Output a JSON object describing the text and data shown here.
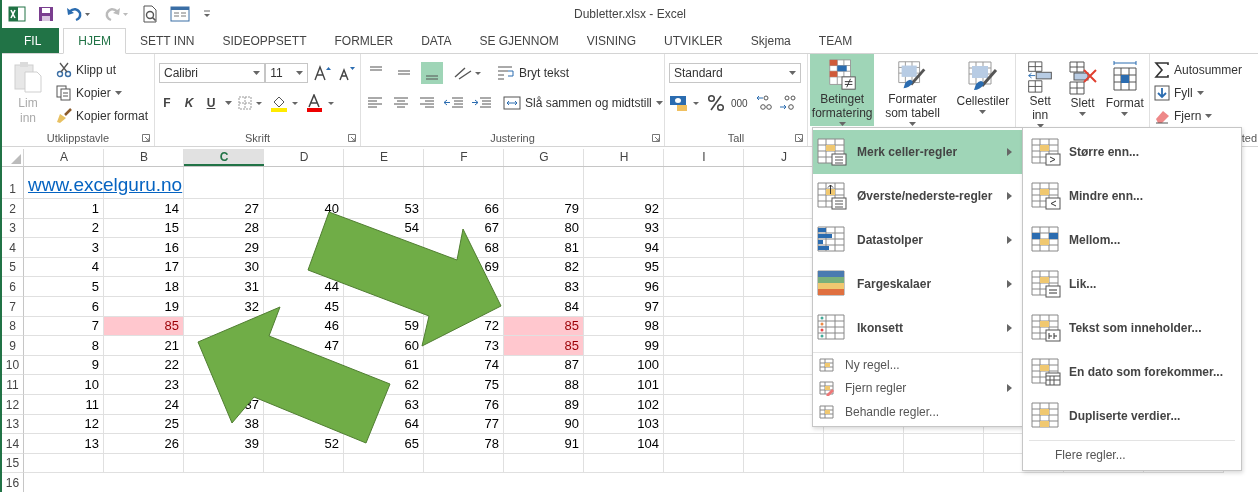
{
  "window": {
    "title": "Dubletter.xlsx - Excel"
  },
  "tabs": [
    {
      "label": "FIL",
      "kind": "file",
      "selected": false
    },
    {
      "label": "HJEM",
      "kind": "tab",
      "selected": true
    },
    {
      "label": "SETT INN",
      "kind": "tab",
      "selected": false
    },
    {
      "label": "SIDEOPPSETT",
      "kind": "tab",
      "selected": false
    },
    {
      "label": "FORMLER",
      "kind": "tab",
      "selected": false
    },
    {
      "label": "DATA",
      "kind": "tab",
      "selected": false
    },
    {
      "label": "SE GJENNOM",
      "kind": "tab",
      "selected": false
    },
    {
      "label": "VISNING",
      "kind": "tab",
      "selected": false
    },
    {
      "label": "UTVIKLER",
      "kind": "tab",
      "selected": false
    },
    {
      "label": "Skjema",
      "kind": "tab",
      "selected": false
    },
    {
      "label": "TEAM",
      "kind": "tab",
      "selected": false
    }
  ],
  "ribbon": {
    "clipboard": {
      "label": "Utklippstavle",
      "paste": {
        "label": "Lim inn",
        "disabled": true
      },
      "buttons": [
        "Klipp ut",
        "Kopier",
        "Kopier format"
      ]
    },
    "font": {
      "label": "Skrift",
      "font_name": "Calibri",
      "font_size": "11",
      "style_buttons": [
        "F",
        "K",
        "U"
      ]
    },
    "alignment": {
      "label": "Justering",
      "vertical_align": [
        {
          "selected": false
        },
        {
          "selected": false
        },
        {
          "selected": true
        }
      ],
      "wrap_text": "Bryt tekst",
      "merge": "Slå sammen og midtstill"
    },
    "number": {
      "label": "Tall",
      "format": "Standard",
      "thousands": "000"
    },
    "styles": {
      "buttons": [
        {
          "label": "Betinget formatering",
          "selected": true
        },
        {
          "label": "Formater som tabell",
          "selected": false
        },
        {
          "label": "Cellestiler",
          "selected": false
        }
      ]
    },
    "cells": {
      "buttons": [
        "Sett inn",
        "Slett",
        "Format"
      ]
    },
    "editing": {
      "label": "ted",
      "buttons": [
        "Autosummer",
        "Fyll",
        "Fjern"
      ]
    }
  },
  "sheet": {
    "columns": [
      {
        "label": "A",
        "selected": false
      },
      {
        "label": "B",
        "selected": false
      },
      {
        "label": "C",
        "selected": true
      },
      {
        "label": "D",
        "selected": false
      },
      {
        "label": "E",
        "selected": false
      },
      {
        "label": "F",
        "selected": false
      },
      {
        "label": "G",
        "selected": false
      },
      {
        "label": "H",
        "selected": false
      },
      {
        "label": "I",
        "selected": false
      },
      {
        "label": "J",
        "selected": false
      }
    ],
    "rows": [
      {
        "header": "1",
        "cells": [
          {
            "value": "www.excelguru.no",
            "kind": "link",
            "highlighted": false
          }
        ]
      },
      {
        "header": "2",
        "cells": [
          {
            "value": "1",
            "highlighted": false
          },
          {
            "value": "14",
            "highlighted": false
          },
          {
            "value": "27",
            "highlighted": false
          },
          {
            "value": "40",
            "highlighted": false
          },
          {
            "value": "53",
            "highlighted": false
          },
          {
            "value": "66",
            "highlighted": false
          },
          {
            "value": "79",
            "highlighted": false
          },
          {
            "value": "92",
            "highlighted": false
          }
        ]
      },
      {
        "header": "3",
        "cells": [
          {
            "value": "2",
            "highlighted": false
          },
          {
            "value": "15",
            "highlighted": false
          },
          {
            "value": "28",
            "highlighted": false
          },
          null,
          {
            "value": "54",
            "highlighted": false
          },
          {
            "value": "67",
            "highlighted": false
          },
          {
            "value": "80",
            "highlighted": false
          },
          {
            "value": "93",
            "highlighted": false
          }
        ]
      },
      {
        "header": "4",
        "cells": [
          {
            "value": "3",
            "highlighted": false
          },
          {
            "value": "16",
            "highlighted": false
          },
          {
            "value": "29",
            "highlighted": false
          },
          null,
          null,
          {
            "value": "68",
            "highlighted": false
          },
          {
            "value": "81",
            "highlighted": false
          },
          {
            "value": "94",
            "highlighted": false
          }
        ]
      },
      {
        "header": "5",
        "cells": [
          {
            "value": "4",
            "highlighted": false
          },
          {
            "value": "17",
            "highlighted": false
          },
          {
            "value": "30",
            "highlighted": false
          },
          null,
          null,
          {
            "value": "69",
            "highlighted": false
          },
          {
            "value": "82",
            "highlighted": false
          },
          {
            "value": "95",
            "highlighted": false
          }
        ]
      },
      {
        "header": "6",
        "cells": [
          {
            "value": "5",
            "highlighted": false
          },
          {
            "value": "18",
            "highlighted": false
          },
          {
            "value": "31",
            "highlighted": false
          },
          {
            "value": "44",
            "highlighted": false
          },
          null,
          null,
          {
            "value": "83",
            "highlighted": false
          },
          {
            "value": "96",
            "highlighted": false
          }
        ]
      },
      {
        "header": "7",
        "cells": [
          {
            "value": "6",
            "highlighted": false
          },
          {
            "value": "19",
            "highlighted": false
          },
          {
            "value": "32",
            "highlighted": false
          },
          {
            "value": "45",
            "highlighted": false
          },
          null,
          null,
          {
            "value": "84",
            "highlighted": false
          },
          {
            "value": "97",
            "highlighted": false
          }
        ]
      },
      {
        "header": "8",
        "cells": [
          {
            "value": "7",
            "highlighted": false
          },
          {
            "value": "85",
            "highlighted": true
          },
          null,
          {
            "value": "46",
            "highlighted": false
          },
          {
            "value": "59",
            "highlighted": false
          },
          {
            "value": "72",
            "highlighted": false
          },
          {
            "value": "85",
            "highlighted": true
          },
          {
            "value": "98",
            "highlighted": false
          }
        ]
      },
      {
        "header": "9",
        "cells": [
          {
            "value": "8",
            "highlighted": false
          },
          {
            "value": "21",
            "highlighted": false
          },
          null,
          {
            "value": "47",
            "highlighted": false
          },
          {
            "value": "60",
            "highlighted": false
          },
          {
            "value": "73",
            "highlighted": false
          },
          {
            "value": "85",
            "highlighted": true
          },
          {
            "value": "99",
            "highlighted": false
          }
        ]
      },
      {
        "header": "10",
        "cells": [
          {
            "value": "9",
            "highlighted": false
          },
          {
            "value": "22",
            "highlighted": false
          },
          null,
          null,
          {
            "value": "61",
            "highlighted": false
          },
          {
            "value": "74",
            "highlighted": false
          },
          {
            "value": "87",
            "highlighted": false
          },
          {
            "value": "100",
            "highlighted": false
          }
        ]
      },
      {
        "header": "11",
        "cells": [
          {
            "value": "10",
            "highlighted": false
          },
          {
            "value": "23",
            "highlighted": false
          },
          null,
          null,
          {
            "value": "62",
            "highlighted": false
          },
          {
            "value": "75",
            "highlighted": false
          },
          {
            "value": "88",
            "highlighted": false
          },
          {
            "value": "101",
            "highlighted": false
          }
        ]
      },
      {
        "header": "12",
        "cells": [
          {
            "value": "11",
            "highlighted": false
          },
          {
            "value": "24",
            "highlighted": false
          },
          {
            "value": "37",
            "highlighted": false
          },
          null,
          {
            "value": "63",
            "highlighted": false
          },
          {
            "value": "76",
            "highlighted": false
          },
          {
            "value": "89",
            "highlighted": false
          },
          {
            "value": "102",
            "highlighted": false
          }
        ]
      },
      {
        "header": "13",
        "cells": [
          {
            "value": "12",
            "highlighted": false
          },
          {
            "value": "25",
            "highlighted": false
          },
          {
            "value": "38",
            "highlighted": false
          },
          null,
          {
            "value": "64",
            "highlighted": false
          },
          {
            "value": "77",
            "highlighted": false
          },
          {
            "value": "90",
            "highlighted": false
          },
          {
            "value": "103",
            "highlighted": false
          }
        ]
      },
      {
        "header": "14",
        "cells": [
          {
            "value": "13",
            "highlighted": false
          },
          {
            "value": "26",
            "highlighted": false
          },
          {
            "value": "39",
            "highlighted": false
          },
          {
            "value": "52",
            "highlighted": false
          },
          {
            "value": "65",
            "highlighted": false
          },
          {
            "value": "78",
            "highlighted": false
          },
          {
            "value": "91",
            "highlighted": false
          },
          {
            "value": "104",
            "highlighted": false
          }
        ]
      },
      {
        "header": "15",
        "cells": []
      },
      {
        "header": "16",
        "cells": []
      }
    ]
  },
  "conditional_menu": {
    "items": [
      {
        "label": "Merk celler-regler",
        "kind": "large",
        "selected": true,
        "has_submenu": true
      },
      {
        "label": "Øverste/nederste-regler",
        "kind": "large",
        "selected": false,
        "has_submenu": true
      },
      {
        "label": "Datastolper",
        "kind": "large",
        "selected": false,
        "has_submenu": true
      },
      {
        "label": "Fargeskalaer",
        "kind": "large",
        "selected": false,
        "has_submenu": true
      },
      {
        "label": "Ikonsett",
        "kind": "large",
        "selected": false,
        "has_submenu": true
      },
      {
        "label": "Ny regel...",
        "kind": "small",
        "selected": false,
        "has_submenu": false
      },
      {
        "label": "Fjern regler",
        "kind": "small",
        "selected": false,
        "has_submenu": true
      },
      {
        "label": "Behandle regler...",
        "kind": "small",
        "selected": false,
        "has_submenu": false
      }
    ],
    "submenu": {
      "items": [
        "Større enn...",
        "Mindre enn...",
        "Mellom...",
        "Lik...",
        "Tekst som inneholder...",
        "En dato som forekommer...",
        "Dupliserte verdier..."
      ],
      "footer": "Flere regler..."
    }
  }
}
